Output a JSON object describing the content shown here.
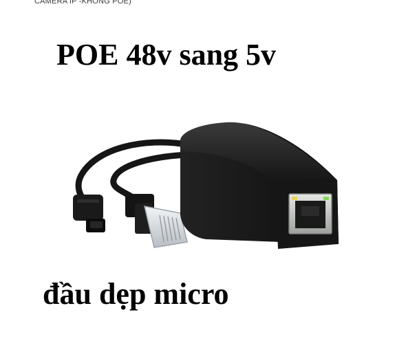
{
  "top_caption": "CAMERA IP -KHÔNG POE)",
  "headline": "POE 48v sang 5v",
  "footer_label": "đầu dẹp micro",
  "image": {
    "subject": "poe-splitter-photo",
    "colors": {
      "body": "#1c1c1c",
      "port_metal": "#c9cbc9",
      "connector": "#cfd3d6"
    }
  }
}
